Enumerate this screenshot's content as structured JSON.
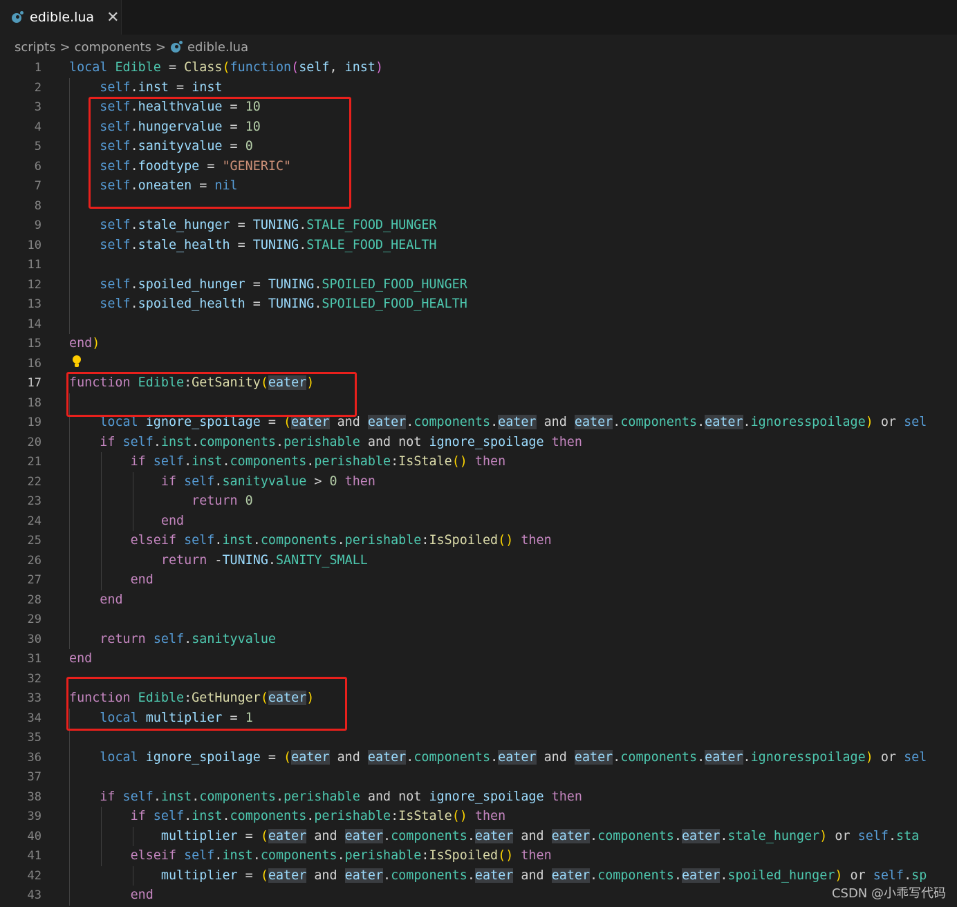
{
  "tab": {
    "title": "edible.lua",
    "close": "✕",
    "icon": "lua-file-icon"
  },
  "breadcrumb": {
    "items": [
      "scripts",
      "components",
      "edible.lua"
    ],
    "separator": ">"
  },
  "active_line": 17,
  "colors": {
    "background": "#1e1e1e",
    "keyword": "#569cd6",
    "control": "#c586c0",
    "function": "#dcdcaa",
    "variable": "#9cdcfe",
    "property": "#4ec9b0",
    "number": "#b5cea8",
    "string": "#ce9178",
    "highlight_box": "#e8201c"
  },
  "watermark": "CSDN @小乖写代码",
  "lines": [
    [
      [
        "kw",
        "local "
      ],
      [
        "cls",
        "Edible"
      ],
      [
        "op",
        " = "
      ],
      [
        "fn",
        "Class"
      ],
      [
        "bracket1",
        "("
      ],
      [
        "kw",
        "function"
      ],
      [
        "bracket2",
        "("
      ],
      [
        "var",
        "self"
      ],
      [
        "op",
        ", "
      ],
      [
        "var",
        "inst"
      ],
      [
        "bracket2",
        ")"
      ]
    ],
    [
      [
        "op",
        "    "
      ],
      [
        "kw",
        "self"
      ],
      [
        "op",
        "."
      ],
      [
        "var",
        "inst"
      ],
      [
        "op",
        " = "
      ],
      [
        "var",
        "inst"
      ]
    ],
    [
      [
        "op",
        "    "
      ],
      [
        "kw",
        "self"
      ],
      [
        "op",
        "."
      ],
      [
        "var",
        "healthvalue"
      ],
      [
        "op",
        " = "
      ],
      [
        "num",
        "10"
      ]
    ],
    [
      [
        "op",
        "    "
      ],
      [
        "kw",
        "self"
      ],
      [
        "op",
        "."
      ],
      [
        "var",
        "hungervalue"
      ],
      [
        "op",
        " = "
      ],
      [
        "num",
        "10"
      ]
    ],
    [
      [
        "op",
        "    "
      ],
      [
        "kw",
        "self"
      ],
      [
        "op",
        "."
      ],
      [
        "var",
        "sanityvalue"
      ],
      [
        "op",
        " = "
      ],
      [
        "num",
        "0"
      ]
    ],
    [
      [
        "op",
        "    "
      ],
      [
        "kw",
        "self"
      ],
      [
        "op",
        "."
      ],
      [
        "var",
        "foodtype"
      ],
      [
        "op",
        " = "
      ],
      [
        "str",
        "\"GENERIC\""
      ]
    ],
    [
      [
        "op",
        "    "
      ],
      [
        "kw",
        "self"
      ],
      [
        "op",
        "."
      ],
      [
        "var",
        "oneaten"
      ],
      [
        "op",
        " = "
      ],
      [
        "nil",
        "nil"
      ]
    ],
    [],
    [
      [
        "op",
        "    "
      ],
      [
        "kw",
        "self"
      ],
      [
        "op",
        "."
      ],
      [
        "var",
        "stale_hunger"
      ],
      [
        "op",
        " = "
      ],
      [
        "var",
        "TUNING"
      ],
      [
        "op",
        "."
      ],
      [
        "prop",
        "STALE_FOOD_HUNGER"
      ]
    ],
    [
      [
        "op",
        "    "
      ],
      [
        "kw",
        "self"
      ],
      [
        "op",
        "."
      ],
      [
        "var",
        "stale_health"
      ],
      [
        "op",
        " = "
      ],
      [
        "var",
        "TUNING"
      ],
      [
        "op",
        "."
      ],
      [
        "prop",
        "STALE_FOOD_HEALTH"
      ]
    ],
    [],
    [
      [
        "op",
        "    "
      ],
      [
        "kw",
        "self"
      ],
      [
        "op",
        "."
      ],
      [
        "var",
        "spoiled_hunger"
      ],
      [
        "op",
        " = "
      ],
      [
        "var",
        "TUNING"
      ],
      [
        "op",
        "."
      ],
      [
        "prop",
        "SPOILED_FOOD_HUNGER"
      ]
    ],
    [
      [
        "op",
        "    "
      ],
      [
        "kw",
        "self"
      ],
      [
        "op",
        "."
      ],
      [
        "var",
        "spoiled_health"
      ],
      [
        "op",
        " = "
      ],
      [
        "var",
        "TUNING"
      ],
      [
        "op",
        "."
      ],
      [
        "prop",
        "SPOILED_FOOD_HEALTH"
      ]
    ],
    [],
    [
      [
        "ctl",
        "end"
      ],
      [
        "bracket1",
        ")"
      ]
    ],
    [],
    [
      [
        "ctl",
        "function "
      ],
      [
        "cls",
        "Edible"
      ],
      [
        "op",
        ":"
      ],
      [
        "fn",
        "GetSanity"
      ],
      [
        "bracket1",
        "("
      ],
      [
        "hl",
        "eater"
      ],
      [
        "bracket1",
        ")"
      ]
    ],
    [],
    [
      [
        "op",
        "    "
      ],
      [
        "kw",
        "local "
      ],
      [
        "var",
        "ignore_spoilage"
      ],
      [
        "op",
        " = "
      ],
      [
        "bracket1",
        "("
      ],
      [
        "hl",
        "eater"
      ],
      [
        "op",
        " and "
      ],
      [
        "hl",
        "eater"
      ],
      [
        "op",
        "."
      ],
      [
        "prop",
        "components"
      ],
      [
        "op",
        "."
      ],
      [
        "hl",
        "eater"
      ],
      [
        "op",
        " and "
      ],
      [
        "hl",
        "eater"
      ],
      [
        "op",
        "."
      ],
      [
        "prop",
        "components"
      ],
      [
        "op",
        "."
      ],
      [
        "hl",
        "eater"
      ],
      [
        "op",
        "."
      ],
      [
        "prop",
        "ignoresspoilage"
      ],
      [
        "bracket1",
        ")"
      ],
      [
        "op",
        " or "
      ],
      [
        "kw",
        "sel"
      ]
    ],
    [
      [
        "op",
        "    "
      ],
      [
        "ctl",
        "if "
      ],
      [
        "kw",
        "self"
      ],
      [
        "op",
        "."
      ],
      [
        "prop",
        "inst"
      ],
      [
        "op",
        "."
      ],
      [
        "prop",
        "components"
      ],
      [
        "op",
        "."
      ],
      [
        "prop",
        "perishable"
      ],
      [
        "op",
        " and not "
      ],
      [
        "var",
        "ignore_spoilage"
      ],
      [
        "ctl",
        " then"
      ]
    ],
    [
      [
        "op",
        "        "
      ],
      [
        "ctl",
        "if "
      ],
      [
        "kw",
        "self"
      ],
      [
        "op",
        "."
      ],
      [
        "prop",
        "inst"
      ],
      [
        "op",
        "."
      ],
      [
        "prop",
        "components"
      ],
      [
        "op",
        "."
      ],
      [
        "prop",
        "perishable"
      ],
      [
        "op",
        ":"
      ],
      [
        "fn",
        "IsStale"
      ],
      [
        "bracket1",
        "()"
      ],
      [
        "ctl",
        " then"
      ]
    ],
    [
      [
        "op",
        "            "
      ],
      [
        "ctl",
        "if "
      ],
      [
        "kw",
        "self"
      ],
      [
        "op",
        "."
      ],
      [
        "prop",
        "sanityvalue"
      ],
      [
        "op",
        " > "
      ],
      [
        "num",
        "0"
      ],
      [
        "ctl",
        " then"
      ]
    ],
    [
      [
        "op",
        "                "
      ],
      [
        "ctl",
        "return "
      ],
      [
        "num",
        "0"
      ]
    ],
    [
      [
        "op",
        "            "
      ],
      [
        "ctl",
        "end"
      ]
    ],
    [
      [
        "op",
        "        "
      ],
      [
        "ctl",
        "elseif "
      ],
      [
        "kw",
        "self"
      ],
      [
        "op",
        "."
      ],
      [
        "prop",
        "inst"
      ],
      [
        "op",
        "."
      ],
      [
        "prop",
        "components"
      ],
      [
        "op",
        "."
      ],
      [
        "prop",
        "perishable"
      ],
      [
        "op",
        ":"
      ],
      [
        "fn",
        "IsSpoiled"
      ],
      [
        "bracket1",
        "()"
      ],
      [
        "ctl",
        " then"
      ]
    ],
    [
      [
        "op",
        "            "
      ],
      [
        "ctl",
        "return "
      ],
      [
        "op",
        "-"
      ],
      [
        "var",
        "TUNING"
      ],
      [
        "op",
        "."
      ],
      [
        "prop",
        "SANITY_SMALL"
      ]
    ],
    [
      [
        "op",
        "        "
      ],
      [
        "ctl",
        "end"
      ]
    ],
    [
      [
        "op",
        "    "
      ],
      [
        "ctl",
        "end"
      ]
    ],
    [],
    [
      [
        "op",
        "    "
      ],
      [
        "ctl",
        "return "
      ],
      [
        "kw",
        "self"
      ],
      [
        "op",
        "."
      ],
      [
        "prop",
        "sanityvalue"
      ]
    ],
    [
      [
        "ctl",
        "end"
      ]
    ],
    [],
    [
      [
        "ctl",
        "function "
      ],
      [
        "cls",
        "Edible"
      ],
      [
        "op",
        ":"
      ],
      [
        "fn",
        "GetHunger"
      ],
      [
        "bracket1",
        "("
      ],
      [
        "hl",
        "eater"
      ],
      [
        "bracket1",
        ")"
      ]
    ],
    [
      [
        "op",
        "    "
      ],
      [
        "kw",
        "local "
      ],
      [
        "var",
        "multiplier"
      ],
      [
        "op",
        " = "
      ],
      [
        "num",
        "1"
      ]
    ],
    [],
    [
      [
        "op",
        "    "
      ],
      [
        "kw",
        "local "
      ],
      [
        "var",
        "ignore_spoilage"
      ],
      [
        "op",
        " = "
      ],
      [
        "bracket1",
        "("
      ],
      [
        "hl",
        "eater"
      ],
      [
        "op",
        " and "
      ],
      [
        "hl",
        "eater"
      ],
      [
        "op",
        "."
      ],
      [
        "prop",
        "components"
      ],
      [
        "op",
        "."
      ],
      [
        "hl",
        "eater"
      ],
      [
        "op",
        " and "
      ],
      [
        "hl",
        "eater"
      ],
      [
        "op",
        "."
      ],
      [
        "prop",
        "components"
      ],
      [
        "op",
        "."
      ],
      [
        "hl",
        "eater"
      ],
      [
        "op",
        "."
      ],
      [
        "prop",
        "ignoresspoilage"
      ],
      [
        "bracket1",
        ")"
      ],
      [
        "op",
        " or "
      ],
      [
        "kw",
        "sel"
      ]
    ],
    [],
    [
      [
        "op",
        "    "
      ],
      [
        "ctl",
        "if "
      ],
      [
        "kw",
        "self"
      ],
      [
        "op",
        "."
      ],
      [
        "prop",
        "inst"
      ],
      [
        "op",
        "."
      ],
      [
        "prop",
        "components"
      ],
      [
        "op",
        "."
      ],
      [
        "prop",
        "perishable"
      ],
      [
        "op",
        " and not "
      ],
      [
        "var",
        "ignore_spoilage"
      ],
      [
        "ctl",
        " then"
      ]
    ],
    [
      [
        "op",
        "        "
      ],
      [
        "ctl",
        "if "
      ],
      [
        "kw",
        "self"
      ],
      [
        "op",
        "."
      ],
      [
        "prop",
        "inst"
      ],
      [
        "op",
        "."
      ],
      [
        "prop",
        "components"
      ],
      [
        "op",
        "."
      ],
      [
        "prop",
        "perishable"
      ],
      [
        "op",
        ":"
      ],
      [
        "fn",
        "IsStale"
      ],
      [
        "bracket1",
        "()"
      ],
      [
        "ctl",
        " then"
      ]
    ],
    [
      [
        "op",
        "            "
      ],
      [
        "var",
        "multiplier"
      ],
      [
        "op",
        " = "
      ],
      [
        "bracket1",
        "("
      ],
      [
        "hl",
        "eater"
      ],
      [
        "op",
        " and "
      ],
      [
        "hl",
        "eater"
      ],
      [
        "op",
        "."
      ],
      [
        "prop",
        "components"
      ],
      [
        "op",
        "."
      ],
      [
        "hl",
        "eater"
      ],
      [
        "op",
        " and "
      ],
      [
        "hl",
        "eater"
      ],
      [
        "op",
        "."
      ],
      [
        "prop",
        "components"
      ],
      [
        "op",
        "."
      ],
      [
        "hl",
        "eater"
      ],
      [
        "op",
        "."
      ],
      [
        "prop",
        "stale_hunger"
      ],
      [
        "bracket1",
        ")"
      ],
      [
        "op",
        " or "
      ],
      [
        "kw",
        "self"
      ],
      [
        "op",
        "."
      ],
      [
        "prop",
        "sta"
      ]
    ],
    [
      [
        "op",
        "        "
      ],
      [
        "ctl",
        "elseif "
      ],
      [
        "kw",
        "self"
      ],
      [
        "op",
        "."
      ],
      [
        "prop",
        "inst"
      ],
      [
        "op",
        "."
      ],
      [
        "prop",
        "components"
      ],
      [
        "op",
        "."
      ],
      [
        "prop",
        "perishable"
      ],
      [
        "op",
        ":"
      ],
      [
        "fn",
        "IsSpoiled"
      ],
      [
        "bracket1",
        "()"
      ],
      [
        "ctl",
        " then"
      ]
    ],
    [
      [
        "op",
        "            "
      ],
      [
        "var",
        "multiplier"
      ],
      [
        "op",
        " = "
      ],
      [
        "bracket1",
        "("
      ],
      [
        "hl",
        "eater"
      ],
      [
        "op",
        " and "
      ],
      [
        "hl",
        "eater"
      ],
      [
        "op",
        "."
      ],
      [
        "prop",
        "components"
      ],
      [
        "op",
        "."
      ],
      [
        "hl",
        "eater"
      ],
      [
        "op",
        " and "
      ],
      [
        "hl",
        "eater"
      ],
      [
        "op",
        "."
      ],
      [
        "prop",
        "components"
      ],
      [
        "op",
        "."
      ],
      [
        "hl",
        "eater"
      ],
      [
        "op",
        "."
      ],
      [
        "prop",
        "spoiled_hunger"
      ],
      [
        "bracket1",
        ")"
      ],
      [
        "op",
        " or "
      ],
      [
        "kw",
        "self"
      ],
      [
        "op",
        "."
      ],
      [
        "prop",
        "sp"
      ]
    ],
    [
      [
        "op",
        "        "
      ],
      [
        "ctl",
        "end"
      ]
    ]
  ]
}
